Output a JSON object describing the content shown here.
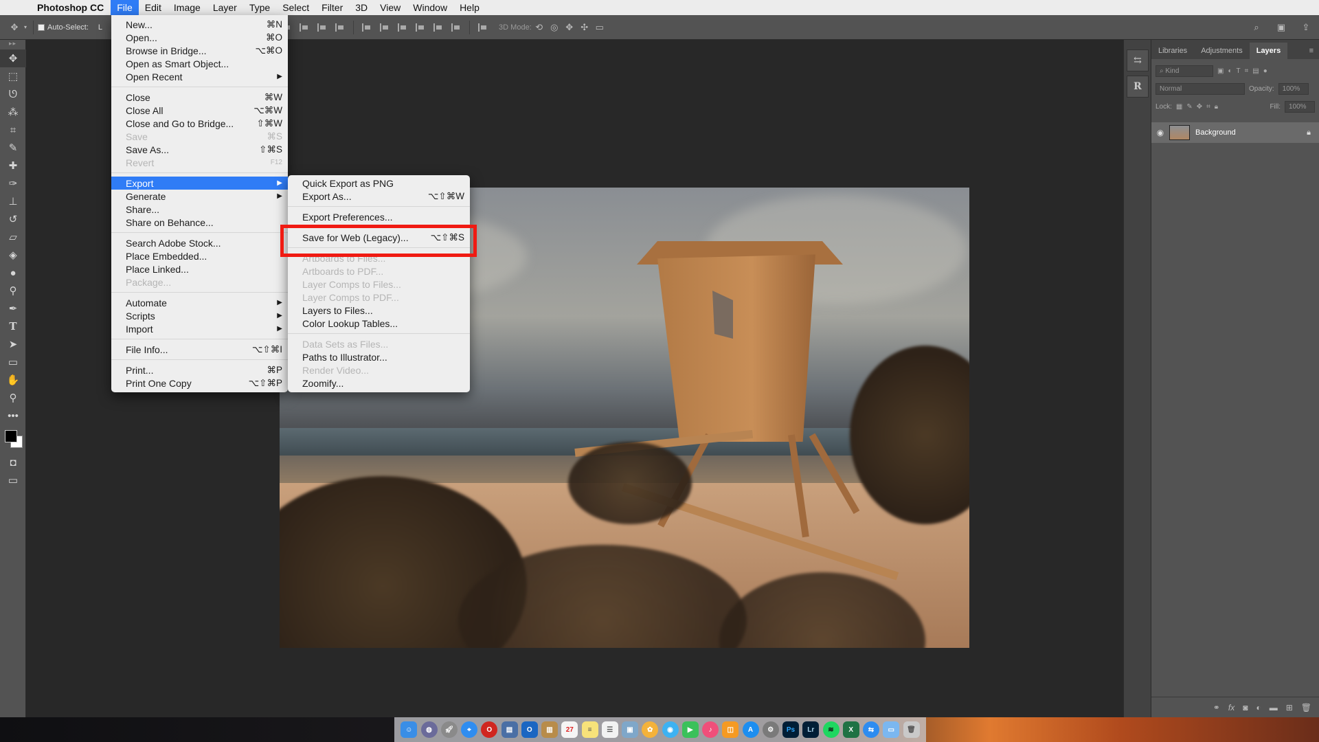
{
  "menubar": {
    "app_name": "Photoshop CC",
    "items": [
      "File",
      "Edit",
      "Image",
      "Layer",
      "Type",
      "Select",
      "Filter",
      "3D",
      "View",
      "Window",
      "Help"
    ]
  },
  "options_bar": {
    "auto_select_label": "Auto-Select:",
    "auto_select_value": "L",
    "mode_3d_label": "3D Mode:"
  },
  "file_menu": {
    "new": "New...",
    "new_sc": "⌘N",
    "open": "Open...",
    "open_sc": "⌘O",
    "browse": "Browse in Bridge...",
    "browse_sc": "⌥⌘O",
    "smart": "Open as Smart Object...",
    "recent": "Open Recent",
    "close": "Close",
    "close_sc": "⌘W",
    "close_all": "Close All",
    "close_all_sc": "⌥⌘W",
    "close_bridge": "Close and Go to Bridge...",
    "close_bridge_sc": "⇧⌘W",
    "save": "Save",
    "save_sc": "⌘S",
    "save_as": "Save As...",
    "save_as_sc": "⇧⌘S",
    "revert": "Revert",
    "revert_sc": "F12",
    "export": "Export",
    "generate": "Generate",
    "share": "Share...",
    "behance": "Share on Behance...",
    "stock": "Search Adobe Stock...",
    "place_embedded": "Place Embedded...",
    "place_linked": "Place Linked...",
    "package": "Package...",
    "automate": "Automate",
    "scripts": "Scripts",
    "import": "Import",
    "file_info": "File Info...",
    "file_info_sc": "⌥⇧⌘I",
    "print": "Print...",
    "print_sc": "⌘P",
    "print_one": "Print One Copy",
    "print_one_sc": "⌥⇧⌘P"
  },
  "export_menu": {
    "quick_png": "Quick Export as PNG",
    "export_as": "Export As...",
    "export_as_sc": "⌥⇧⌘W",
    "prefs": "Export Preferences...",
    "save_web": "Save for Web (Legacy)...",
    "save_web_sc": "⌥⇧⌘S",
    "artboards_files": "Artboards to Files...",
    "artboards_pdf": "Artboards to PDF...",
    "comps_files": "Layer Comps to Files...",
    "comps_pdf": "Layer Comps to PDF...",
    "layers_files": "Layers to Files...",
    "lut": "Color Lookup Tables...",
    "data_sets": "Data Sets as Files...",
    "paths": "Paths to Illustrator...",
    "render_video": "Render Video...",
    "zoomify": "Zoomify..."
  },
  "panel": {
    "tabs": [
      "Libraries",
      "Adjustments",
      "Layers"
    ],
    "filter_kind": "Kind",
    "blend_mode": "Normal",
    "opacity_label": "Opacity:",
    "opacity_value": "100%",
    "lock_label": "Lock:",
    "fill_label": "Fill:",
    "fill_value": "100%",
    "layer_name": "Background"
  },
  "dock_icons": {
    "libraries_glyph": "⇆",
    "pro_glyph": "R"
  },
  "colors": {
    "menu_highlight": "#2f7cf6",
    "annotation_red": "#f01a12"
  }
}
